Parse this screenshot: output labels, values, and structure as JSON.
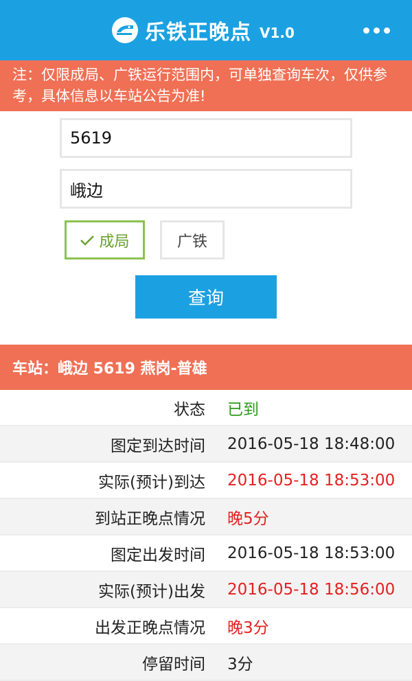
{
  "header": {
    "title": "乐铁正晚点",
    "version": "V1.0",
    "icons": {
      "logo": "train-logo-icon",
      "more": "more-dots-icon"
    }
  },
  "notice": "注：仅限成局、广铁运行范围内，可单独查询车次，仅供参考，具体信息以车站公告为准!",
  "form": {
    "train_number_value": "5619",
    "station_value": "峨边",
    "options": [
      {
        "label": "成局",
        "selected": true
      },
      {
        "label": "广铁",
        "selected": false
      }
    ],
    "query_label": "查询"
  },
  "result": {
    "title": "车站：峨边 5619 燕岗-普雄",
    "rows": [
      {
        "label": "状态",
        "value": "已到",
        "color": "#2e9a1c"
      },
      {
        "label": "图定到达时间",
        "value": "2016-05-18 18:48:00",
        "color": "#222222"
      },
      {
        "label": "实际(预计)到达",
        "value": "2016-05-18 18:53:00",
        "color": "#e52020"
      },
      {
        "label": "到站正晚点情况",
        "value": "晚5分",
        "color": "#e52020"
      },
      {
        "label": "图定出发时间",
        "value": "2016-05-18 18:53:00",
        "color": "#222222"
      },
      {
        "label": "实际(预计)出发",
        "value": "2016-05-18 18:56:00",
        "color": "#e52020"
      },
      {
        "label": "出发正晚点情况",
        "value": "晚3分",
        "color": "#e52020"
      },
      {
        "label": "停留时间",
        "value": "3分",
        "color": "#222222"
      }
    ]
  },
  "colors": {
    "primary": "#1ba1e2",
    "accent": "#f07055",
    "selected": "#8cc152"
  }
}
